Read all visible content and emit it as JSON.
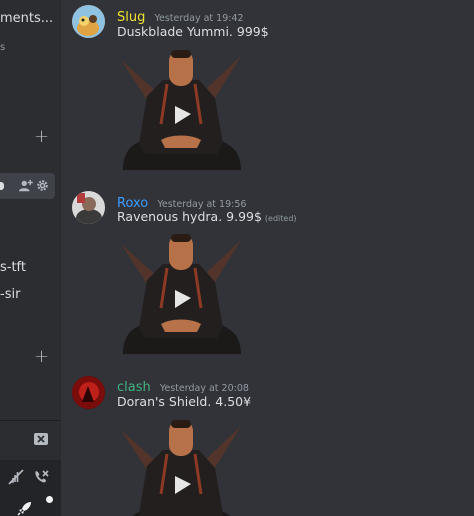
{
  "sidebar": {
    "fragments": [
      {
        "text": "ments..."
      },
      {
        "text": "s"
      },
      {
        "text": "s-tft"
      },
      {
        "text": "-sir"
      }
    ],
    "icons": [
      "plus-icon",
      "add-member-icon",
      "gear-icon",
      "close-icon",
      "mute-icon",
      "phone-disconnect-icon",
      "rocket-icon"
    ]
  },
  "messages": [
    {
      "author": "Slug",
      "author_color": "#f0e130",
      "timestamp": "Yesterday at 19:42",
      "text": "Duskblade Yummi. 999$",
      "edited": ""
    },
    {
      "author": "Roxo",
      "author_color": "#3b9dff",
      "timestamp": "Yesterday at 19:56",
      "text": "Ravenous hydra. 9.99$",
      "edited": "(edited)"
    },
    {
      "author": "clash",
      "author_color": "#43b581",
      "timestamp": "Yesterday at 20:08",
      "text": "Doran's Shield. 4.50¥",
      "edited": ""
    }
  ],
  "colors": {
    "chat_bg": "#313338",
    "sidebar_bg": "#2b2d31",
    "selected_bg": "#404249"
  }
}
